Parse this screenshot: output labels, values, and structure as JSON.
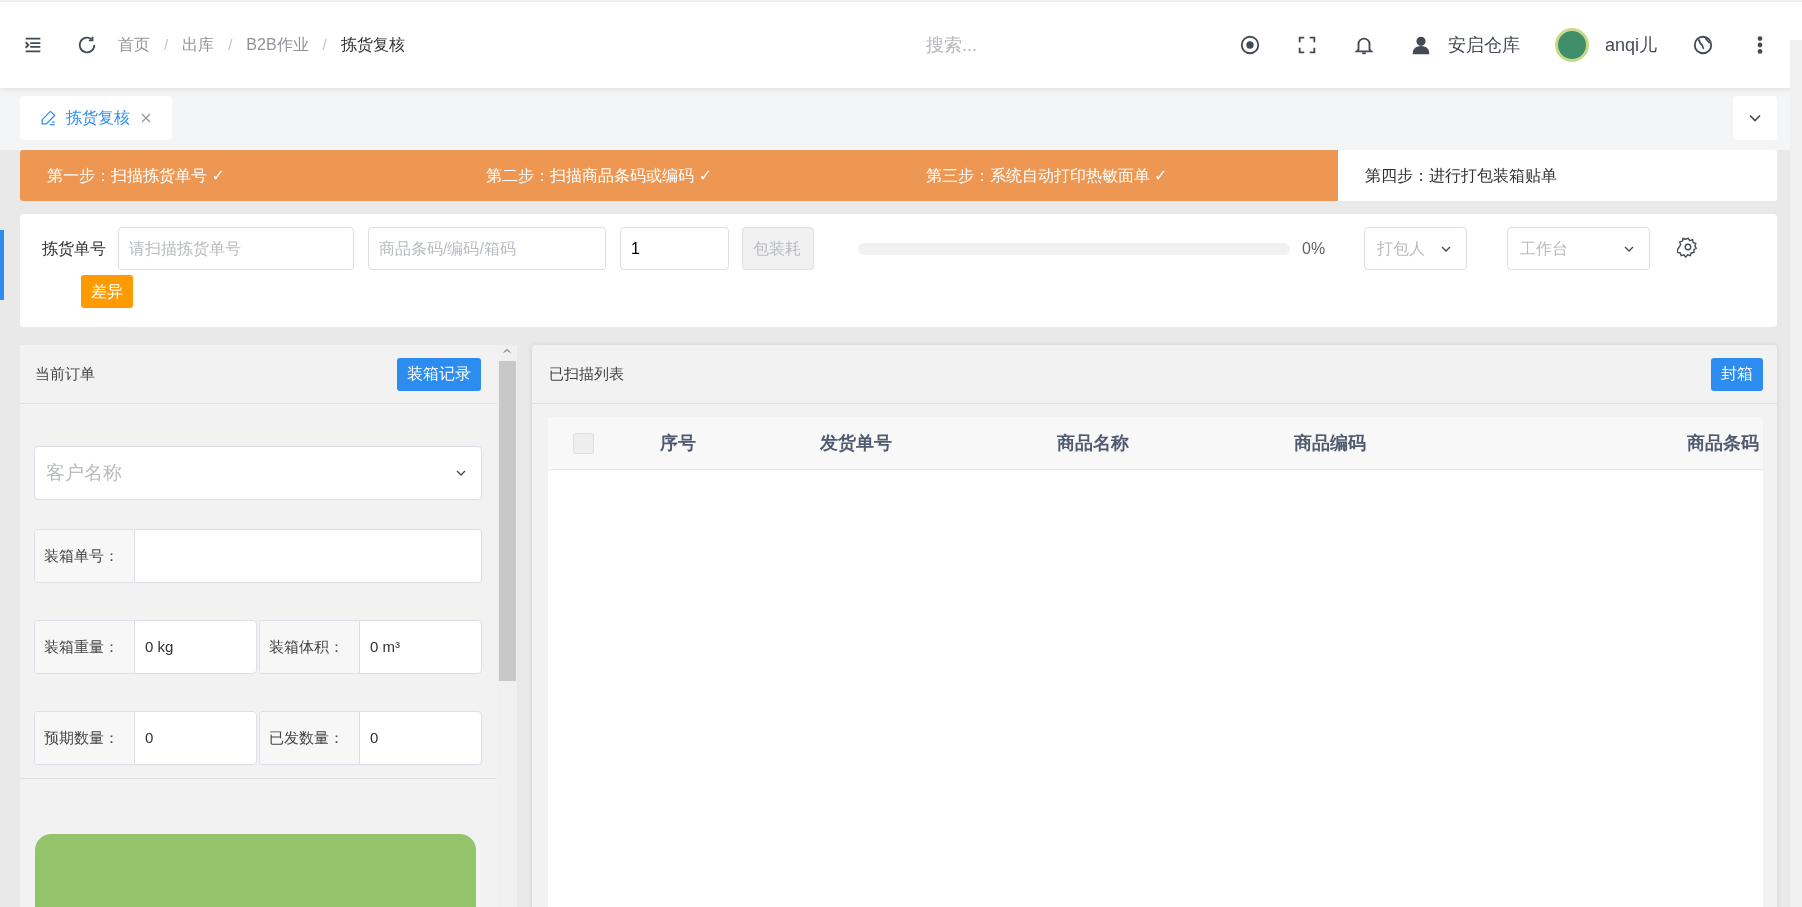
{
  "topbar": {
    "separator": "/",
    "breadcrumb": [
      {
        "label": "首页",
        "current": false
      },
      {
        "label": "出库",
        "current": false
      },
      {
        "label": "B2B作业",
        "current": false
      },
      {
        "label": "拣货复核",
        "current": true
      }
    ],
    "search": {
      "placeholder": "搜索..."
    },
    "warehouse": "安启仓库",
    "user": "anqi儿"
  },
  "tabs": [
    {
      "label": "拣货复核",
      "selected": true
    }
  ],
  "steps": [
    {
      "label": "第一步：扫描拣货单号 ✓",
      "done": true
    },
    {
      "label": "第二步：扫描商品条码或编码 ✓",
      "done": true
    },
    {
      "label": "第三步：系统自动打印热敏面单 ✓",
      "done": true
    },
    {
      "label": "第四步：进行打包装箱贴单",
      "done": false
    }
  ],
  "scan_form": {
    "label": "拣货单号",
    "pick_no": {
      "placeholder": "请扫描拣货单号"
    },
    "barcode": {
      "placeholder": "商品条码/编码/箱码"
    },
    "quantity": {
      "value": "1"
    },
    "packaging": {
      "placeholder": "包装耗",
      "disabled": true
    },
    "progress": {
      "level": 0,
      "reading": "0%"
    },
    "packer": {
      "placeholder": "打包人"
    },
    "workbench": {
      "placeholder": "工作台"
    },
    "diff_button": "差异"
  },
  "current_order": {
    "title": "当前订单",
    "record_button": "装箱记录",
    "customer": {
      "placeholder": "客户名称"
    },
    "rows": [
      [
        {
          "label": "装箱单号："
        }
      ],
      [
        {
          "label": "装箱重量：",
          "value": "0 kg"
        },
        {
          "label": "装箱体积：",
          "value": "0 m³"
        }
      ],
      [
        {
          "label": "预期数量：",
          "value": "0"
        },
        {
          "label": "已发数量：",
          "value": "0"
        }
      ]
    ]
  },
  "scanned_list": {
    "title": "已扫描列表",
    "seal_button": "封箱",
    "select_all": {
      "checked": false
    },
    "columns": [
      "序号",
      "发货单号",
      "商品名称",
      "商品编码",
      "商品条码"
    ]
  }
}
